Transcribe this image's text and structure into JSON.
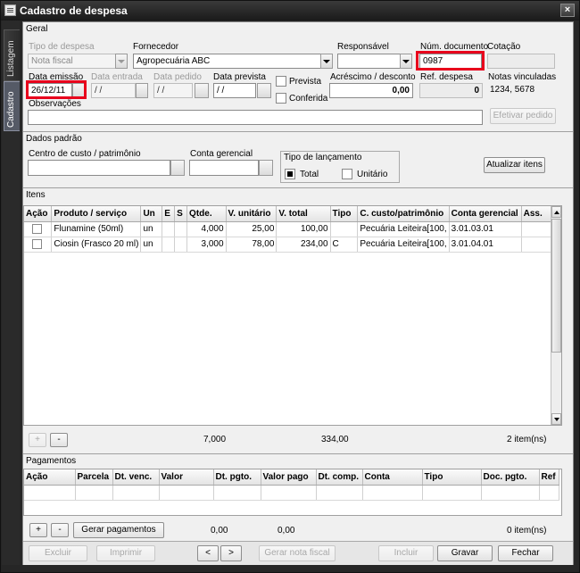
{
  "window": {
    "title": "Cadastro de despesa",
    "close": "×"
  },
  "side_tabs": [
    "Listagem",
    "Cadastro"
  ],
  "geral": {
    "title": "Geral",
    "tipo_despesa_label": "Tipo de despesa",
    "tipo_despesa_value": "Nota fiscal",
    "fornecedor_label": "Fornecedor",
    "fornecedor_value": "Agropecuária ABC",
    "responsavel_label": "Responsável",
    "responsavel_value": "",
    "num_documento_label": "Núm. documento",
    "num_documento_value": "0987",
    "cotacao_label": "Cotação",
    "cotacao_value": "",
    "data_emissao_label": "Data emissão",
    "data_emissao_value": "26/12/11",
    "data_entrada_label": "Data entrada",
    "data_entrada_value": "/ /",
    "data_pedido_label": "Data pedido",
    "data_pedido_value": "/ /",
    "data_prevista_label": "Data prevista",
    "data_prevista_value": "/ /",
    "prevista_label": "Prevista",
    "conferida_label": "Conferida",
    "acrescimo_label": "Acréscimo / desconto",
    "acrescimo_value": "0,00",
    "ref_despesa_label": "Ref. despesa",
    "ref_despesa_value": "0",
    "notas_vinculadas_label": "Notas vinculadas",
    "notas_vinculadas_value": "1234, 5678",
    "observacoes_label": "Observações",
    "observacoes_value": "",
    "efetivar_pedido": "Efetivar pedido"
  },
  "dados_padrao": {
    "title": "Dados padrão",
    "centro_custo_label": "Centro de custo / patrimônio",
    "centro_custo_value": "",
    "conta_gerencial_label": "Conta gerencial",
    "conta_gerencial_value": "",
    "tipo_lancamento_label": "Tipo de lançamento",
    "total_label": "Total",
    "unitario_label": "Unitário",
    "total_checked": true,
    "unitario_checked": false,
    "atualizar_itens": "Atualizar itens"
  },
  "itens": {
    "title": "Itens",
    "columns": [
      "Ação",
      "Produto / serviço",
      "Un",
      "E",
      "S",
      "Qtde.",
      "V. unitário",
      "V. total",
      "Tipo",
      "C. custo/patrimônio",
      "Conta gerencial",
      "Ass."
    ],
    "rows": [
      {
        "produto": "Flunamine (50ml)",
        "un": "un",
        "e": "",
        "s": "",
        "qtde": "4,000",
        "v_unitario": "25,00",
        "v_total": "100,00",
        "tipo": "",
        "ccusto": "Pecuária  Leiteira[100,",
        "conta": "3.01.03.01",
        "ass": ""
      },
      {
        "produto": "Ciosin (Frasco 20 ml)",
        "un": "un",
        "e": "",
        "s": "",
        "qtde": "3,000",
        "v_unitario": "78,00",
        "v_total": "234,00",
        "tipo": "C",
        "ccusto": "Pecuária  Leiteira[100,",
        "conta": "3.01.04.01",
        "ass": ""
      }
    ],
    "add": "+",
    "remove": "-",
    "total_qtde": "7,000",
    "total_valor": "334,00",
    "count": "2  item(ns)"
  },
  "pagamentos": {
    "title": "Pagamentos",
    "columns": [
      "Ação",
      "Parcela",
      "Dt. venc.",
      "Valor",
      "Dt. pgto.",
      "Valor pago",
      "Dt. comp.",
      "Conta",
      "Tipo",
      "Doc. pgto.",
      "Ref"
    ],
    "add": "+",
    "remove": "-",
    "gerar_pagamentos": "Gerar pagamentos",
    "total_valor": "0,00",
    "total_pago": "0,00",
    "count": "0  item(ns)"
  },
  "footer": {
    "excluir": "Excluir",
    "imprimir": "Imprimir",
    "prev": "<",
    "next": ">",
    "gerar_nota_fiscal": "Gerar nota fiscal",
    "incluir": "Incluir",
    "gravar": "Gravar",
    "fechar": "Fechar"
  },
  "colors": {
    "highlight": "#e8001c",
    "window_bg": "#262626",
    "active_tab": "#555a66"
  }
}
